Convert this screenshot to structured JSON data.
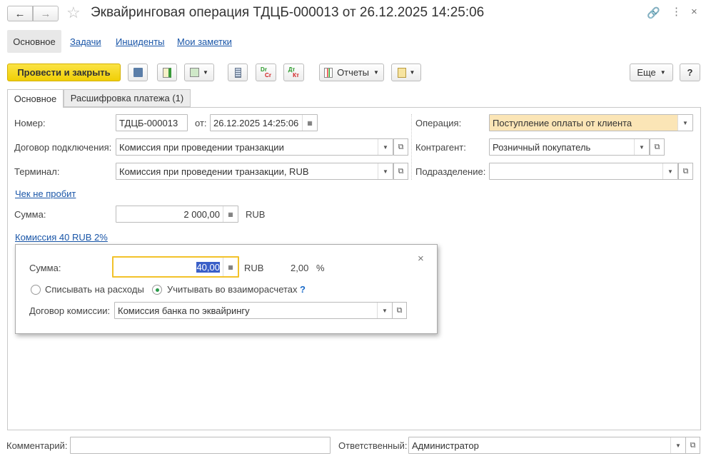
{
  "title": "Эквайринговая операция ТДЦБ-000013 от 26.12.2025 14:25:06",
  "nav": {
    "main": "Основное",
    "tasks": "Задачи",
    "incidents": "Инциденты",
    "notes": "Мои заметки"
  },
  "toolbar": {
    "post_close": "Провести и закрыть",
    "reports": "Отчеты",
    "more": "Еще",
    "help": "?",
    "drcr_top": "Dr",
    "drcr_bottom": "Cr",
    "dtkt_top": "Дт",
    "dtkt_bottom": "Кт"
  },
  "tabs": [
    {
      "label": "Основное",
      "active": true
    },
    {
      "label": "Расшифровка платежа (1)",
      "active": false
    }
  ],
  "form": {
    "number_label": "Номер:",
    "number": "ТДЦБ-000013",
    "from_label": "от:",
    "date": "26.12.2025 14:25:06",
    "operation_label": "Операция:",
    "operation": "Поступление оплаты от клиента",
    "contract_label": "Договор подключения:",
    "contract": "Комиссия при проведении транзакции",
    "counterparty_label": "Контрагент:",
    "counterparty": "Розничный покупатель",
    "terminal_label": "Терминал:",
    "terminal": "Комиссия при проведении транзакции, RUB",
    "division_label": "Подразделение:",
    "division": "",
    "receipt_link": "Чек не пробит",
    "sum_label": "Сумма:",
    "sum": "2 000,00",
    "currency": "RUB",
    "commission_link": "Комиссия 40 RUB 2%"
  },
  "popup": {
    "sum_label": "Сумма:",
    "sum": "40,00",
    "currency": "RUB",
    "percent": "2,00",
    "percent_sign": "%",
    "radio_expense": "Списывать на расходы",
    "radio_settlement": "Учитывать во взаиморасчетах",
    "selected": "settlement",
    "help": "?",
    "contract_label": "Договор комиссии:",
    "contract": "Комиссия банка по эквайрингу",
    "close": "×"
  },
  "footer": {
    "comment_label": "Комментарий:",
    "comment": "",
    "responsible_label": "Ответственный:",
    "responsible": "Администратор"
  },
  "colors": {
    "accent_button": "#f5d611",
    "operation_bg": "#fbe5b6",
    "focus_border": "#f2c22a",
    "link": "#1a56a8"
  }
}
